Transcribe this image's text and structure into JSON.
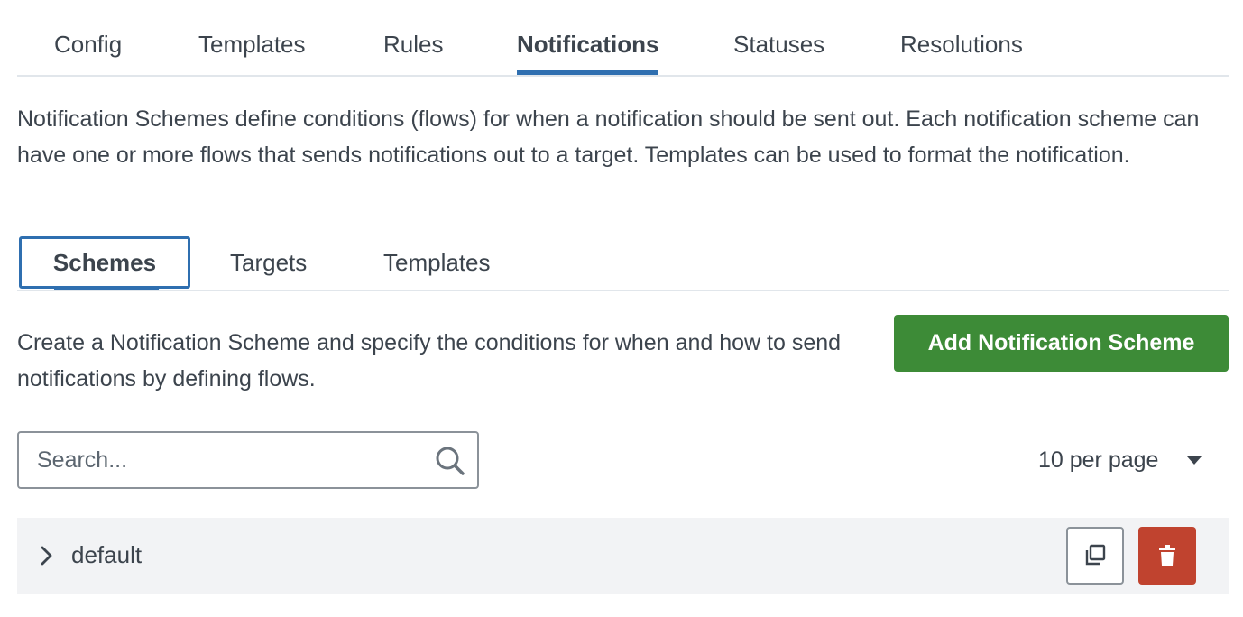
{
  "top_tabs": [
    {
      "label": "Config",
      "active": false
    },
    {
      "label": "Templates",
      "active": false
    },
    {
      "label": "Rules",
      "active": false
    },
    {
      "label": "Notifications",
      "active": true
    },
    {
      "label": "Statuses",
      "active": false
    },
    {
      "label": "Resolutions",
      "active": false
    }
  ],
  "intro": "Notification Schemes define conditions (flows) for when a notification should be sent out. Each notification scheme can have one or more flows that sends notifications out to a target. Templates can be used to format the notification.",
  "sub_tabs": [
    {
      "label": "Schemes",
      "active": true
    },
    {
      "label": "Targets",
      "active": false
    },
    {
      "label": "Templates",
      "active": false
    }
  ],
  "description": "Create a Notification Scheme and specify the conditions for when and how to send notifications by defining flows.",
  "add_button_label": "Add Notification Scheme",
  "search": {
    "placeholder": "Search...",
    "value": "",
    "icon": "search-icon"
  },
  "per_page": {
    "selected": "10 per page"
  },
  "schemes": [
    {
      "name": "default",
      "expand_icon": "chevron-right-icon",
      "actions": [
        "clone-icon",
        "trash-icon"
      ]
    }
  ],
  "colors": {
    "accent": "#2f6fb0",
    "primary_button": "#3d8b37",
    "danger_button": "#c0432f",
    "text": "#3c444d",
    "row_background": "#f2f3f5"
  }
}
